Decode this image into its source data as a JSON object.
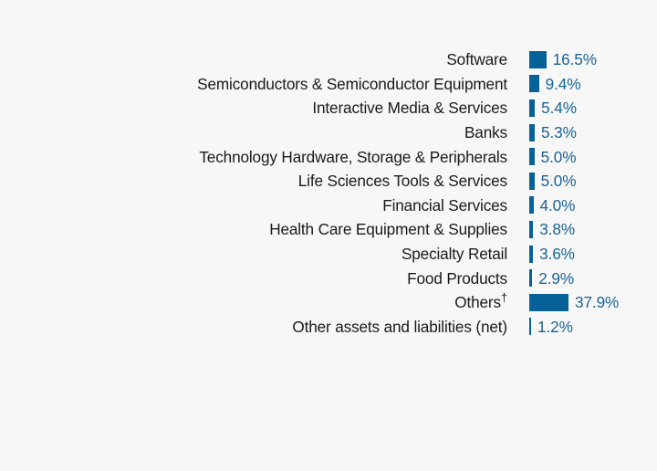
{
  "chart_data": {
    "type": "bar",
    "title": "",
    "subtitle": "",
    "xlabel": "",
    "ylabel": "",
    "orientation": "horizontal",
    "grid": false,
    "legend": null,
    "value_suffix": "%",
    "xlim": [
      0,
      37.9
    ],
    "categories": [
      "Software",
      "Semiconductors & Semiconductor Equipment",
      "Interactive Media & Services",
      "Banks",
      "Technology Hardware, Storage & Peripherals",
      "Life Sciences Tools & Services",
      "Financial Services",
      "Health Care Equipment & Supplies",
      "Specialty Retail",
      "Food Products",
      "Others†",
      "Other assets and liabilities (net)"
    ],
    "values": [
      16.5,
      9.4,
      5.4,
      5.3,
      5.0,
      5.0,
      4.0,
      3.8,
      3.6,
      2.9,
      37.9,
      1.2
    ],
    "value_labels": [
      "16.5%",
      "9.4%",
      "5.4%",
      "5.3%",
      "5.0%",
      "5.0%",
      "4.0%",
      "3.8%",
      "3.6%",
      "2.9%",
      "37.9%",
      "1.2%"
    ],
    "annotations": [
      "† appended to the \"Others\" category label"
    ]
  },
  "colors": {
    "background": "#f7f7f7",
    "bar": "#056198",
    "value_text": "#1a6496",
    "label_text": "#1a1a1a"
  },
  "rows": [
    {
      "label": "Software",
      "value": "16.5%",
      "num": 16.5
    },
    {
      "label": "Semiconductors & Semiconductor Equipment",
      "value": "9.4%",
      "num": 9.4
    },
    {
      "label": "Interactive Media & Services",
      "value": "5.4%",
      "num": 5.4
    },
    {
      "label": "Banks",
      "value": "5.3%",
      "num": 5.3
    },
    {
      "label": "Technology Hardware, Storage & Peripherals",
      "value": "5.0%",
      "num": 5.0
    },
    {
      "label": "Life Sciences Tools & Services",
      "value": "5.0%",
      "num": 5.0
    },
    {
      "label": "Financial Services",
      "value": "4.0%",
      "num": 4.0
    },
    {
      "label": "Health Care Equipment & Supplies",
      "value": "3.8%",
      "num": 3.8
    },
    {
      "label": "Specialty Retail",
      "value": "3.6%",
      "num": 3.6
    },
    {
      "label": "Food Products",
      "value": "2.9%",
      "num": 2.9
    },
    {
      "label": "Others",
      "value": "37.9%",
      "num": 37.9,
      "dagger": "†"
    },
    {
      "label": "Other assets and liabilities (net)",
      "value": "1.2%",
      "num": 1.2
    }
  ]
}
